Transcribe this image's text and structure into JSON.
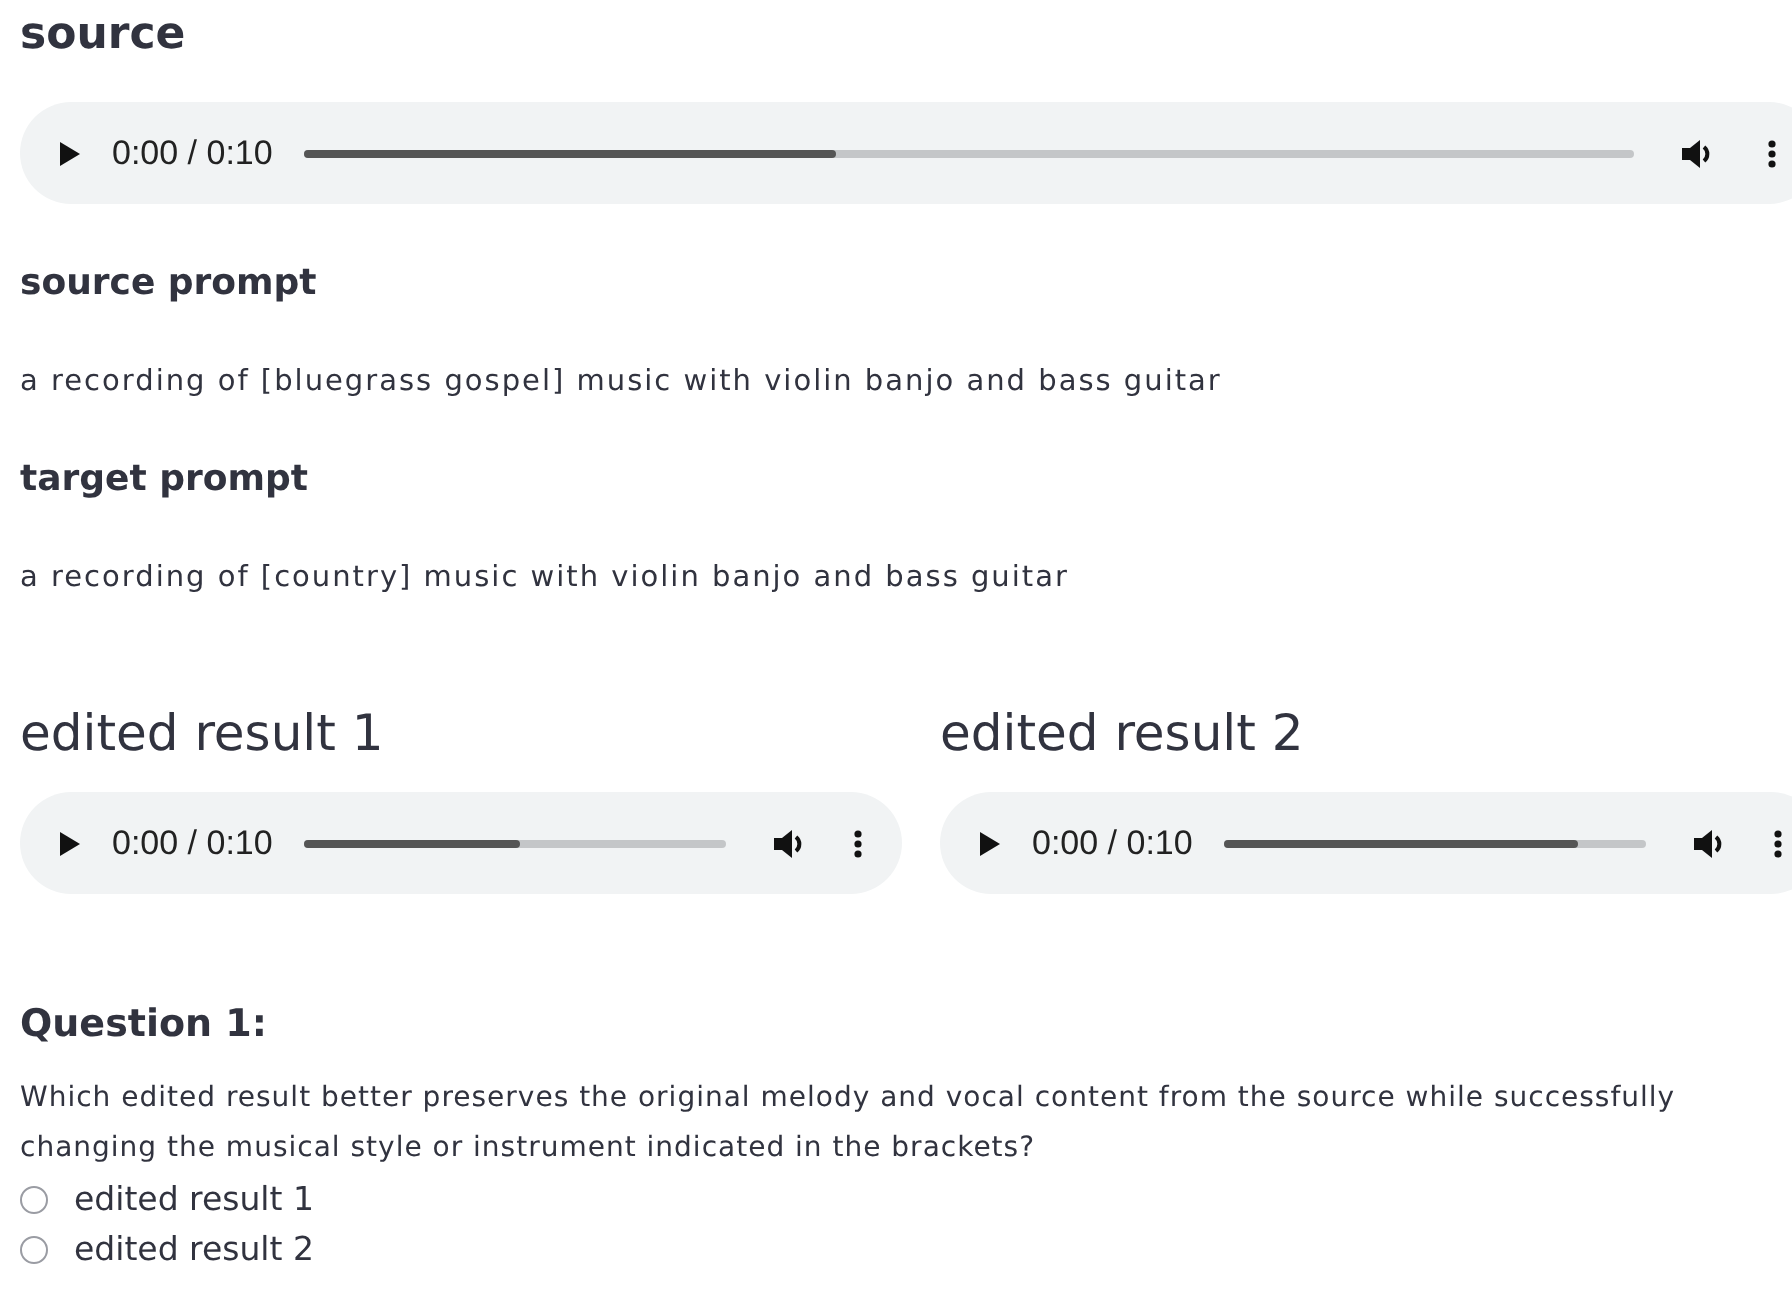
{
  "source": {
    "heading": "source",
    "player": {
      "time": "0:00 / 0:10",
      "level": 0.4
    }
  },
  "prompts": [
    {
      "heading": "source prompt",
      "text": "a recording of [bluegrass gospel] music with violin banjo and bass guitar"
    },
    {
      "heading": "target prompt",
      "text": "a recording of [country] music with violin banjo and bass guitar"
    }
  ],
  "results": [
    {
      "heading": "edited result 1",
      "player": {
        "time": "0:00 / 0:10",
        "level": 0.51
      }
    },
    {
      "heading": "edited result 2",
      "player": {
        "time": "0:00 / 0:10",
        "level": 0.84
      }
    }
  ],
  "question": {
    "title": "Question 1:",
    "text": "Which edited result better preserves the original melody and vocal content from the source while successfully changing the musical style or instrument indicated in the brackets?",
    "options": [
      {
        "label": "edited result 1",
        "selected": false
      },
      {
        "label": "edited result 2",
        "selected": false
      }
    ]
  }
}
